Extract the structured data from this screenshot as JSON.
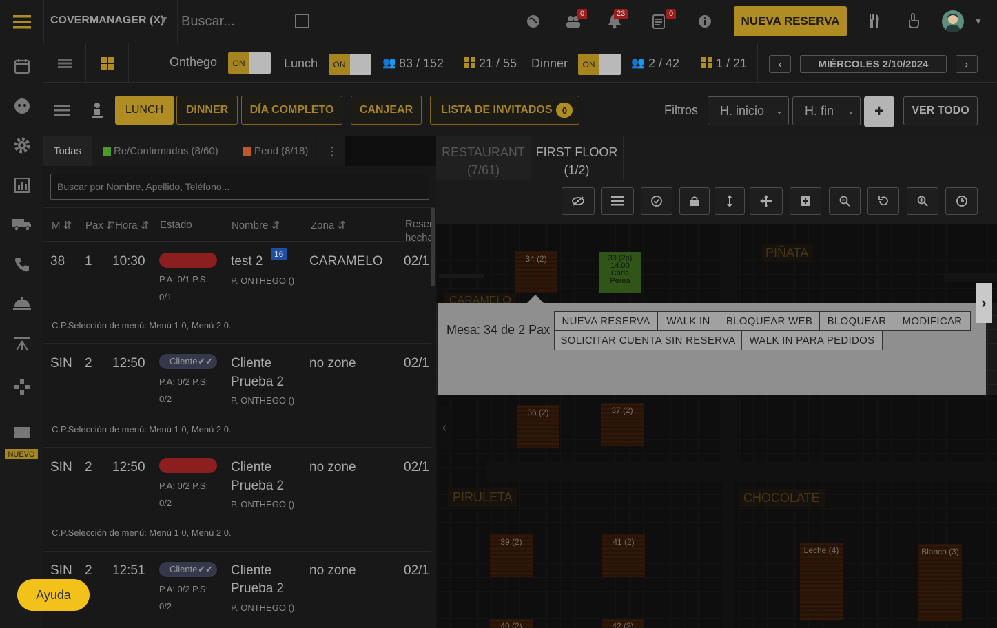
{
  "header": {
    "account": "COVERMANAGER (X)",
    "search_placeholder": "Buscar...",
    "badges": {
      "people": "0",
      "bell": "23",
      "clipboard": "0"
    },
    "new_reservation": "NUEVA RESERVA"
  },
  "status_bar": {
    "onthego_label": "Onthego",
    "onthego_toggle": "ON",
    "lunch_label": "Lunch",
    "lunch_toggle": "ON",
    "lunch_pax": "83 / 152",
    "lunch_tables": "21 / 55",
    "dinner_label": "Dinner",
    "dinner_toggle": "ON",
    "dinner_pax": "2 / 42",
    "dinner_tables": "1 / 21",
    "date": "MIÉRCOLES 2/10/2024"
  },
  "toolbar": {
    "lunch": "LUNCH",
    "dinner": "DINNER",
    "full_day": "DÍA COMPLETO",
    "redeem": "CANJEAR",
    "guest_list": "LISTA DE INVITADOS",
    "guest_count": "0",
    "filters_label": "Filtros",
    "start_hour": "H. inicio",
    "end_hour": "H. fin",
    "plus": "+",
    "see_all": "VER TODO"
  },
  "list": {
    "tabs": {
      "all": "Todas",
      "confirmed": "Re/Confirmadas (8/60)",
      "pending": "Pend (8/18)",
      "more": "⋮"
    },
    "search_placeholder": "Buscar por Nombre, Apellido, Teléfono...",
    "columns": {
      "m": "M",
      "pax": "Pax",
      "hour": "Hora",
      "status": "Estado",
      "name": "Nombre",
      "zone": "Zona",
      "made": "Reser hecha"
    },
    "rows": [
      {
        "m": "38",
        "pax": "1",
        "hour": "10:30",
        "pill": "",
        "pa": "P.A: 0/1 P.S:",
        "ps": "0/1",
        "name1": "test 2",
        "name2": "",
        "badge": "16",
        "company": "P. ONTHEGO ()",
        "zone": "CARAMELO",
        "date": "02/1",
        "note": "C.P.Selección de menú: Menú 1 0, Menú 2 0."
      },
      {
        "m": "SIN",
        "pax": "2",
        "hour": "12:50",
        "pill": "Cliente",
        "pa": "P.A: 0/2 P.S:",
        "ps": "0/2",
        "name1": "Cliente",
        "name2": "Prueba 2",
        "badge": "",
        "company": "P. ONTHEGO ()",
        "zone": "no zone",
        "date": "02/1",
        "note": "C.P.Selección de menú: Menú 1 0, Menú 2 0."
      },
      {
        "m": "SIN",
        "pax": "2",
        "hour": "12:50",
        "pill": "",
        "pa": "P.A: 0/2 P.S:",
        "ps": "0/2",
        "name1": "Cliente",
        "name2": "Prueba 2",
        "badge": "",
        "company": "P. ONTHEGO ()",
        "zone": "no zone",
        "date": "02/1",
        "note": "C.P.Selección de menú: Menú 1 0, Menú 2 0."
      },
      {
        "m": "SIN",
        "pax": "2",
        "hour": "12:51",
        "pill": "Cliente",
        "pa": "P.A: 0/2 P.S:",
        "ps": "0/2",
        "name1": "Cliente",
        "name2": "Prueba 2",
        "badge": "",
        "company": "P. ONTHEGO ()",
        "zone": "no zone",
        "date": "02/1",
        "note": ""
      }
    ]
  },
  "floor": {
    "tabs": {
      "restaurant": "RESTAURANT",
      "restaurant_count": "(7/61)",
      "first_floor": "FIRST FLOOR",
      "first_floor_count": "(1/2)"
    },
    "zones": {
      "pinata": "PIÑATA",
      "caramelo": "CARAMELO",
      "piruleta": "PIRULETA",
      "chocolate": "CHOCOLATE"
    },
    "tables": {
      "t34": "34 (2)",
      "t33": [
        "33 (2p)",
        "14:00",
        "Carla",
        "Perea"
      ],
      "t36": "36 (2)",
      "t37": "37 (2)",
      "t39": "39 (2)",
      "t41": "41 (2)",
      "t40": "40 (2)",
      "t42": "42 (2)",
      "leche": "Leche (4)",
      "blanco": "Blanco (3)"
    }
  },
  "popup": {
    "label": "Mesa: 34 de 2 Pax",
    "buttons": [
      "NUEVA RESERVA",
      "WALK IN",
      "BLOQUEAR WEB",
      "BLOQUEAR",
      "MODIFICAR",
      "SOLICITAR CUENTA SIN RESERVA",
      "WALK IN PARA PEDIDOS"
    ]
  },
  "sidebar": {
    "new_label": "NUEVO"
  },
  "help": "Ayuda",
  "colors": {
    "gold": "#b08d22",
    "confirmed": "#4c9a2a",
    "pending": "#c0592a",
    "pill_red": "#8b1e1e"
  }
}
